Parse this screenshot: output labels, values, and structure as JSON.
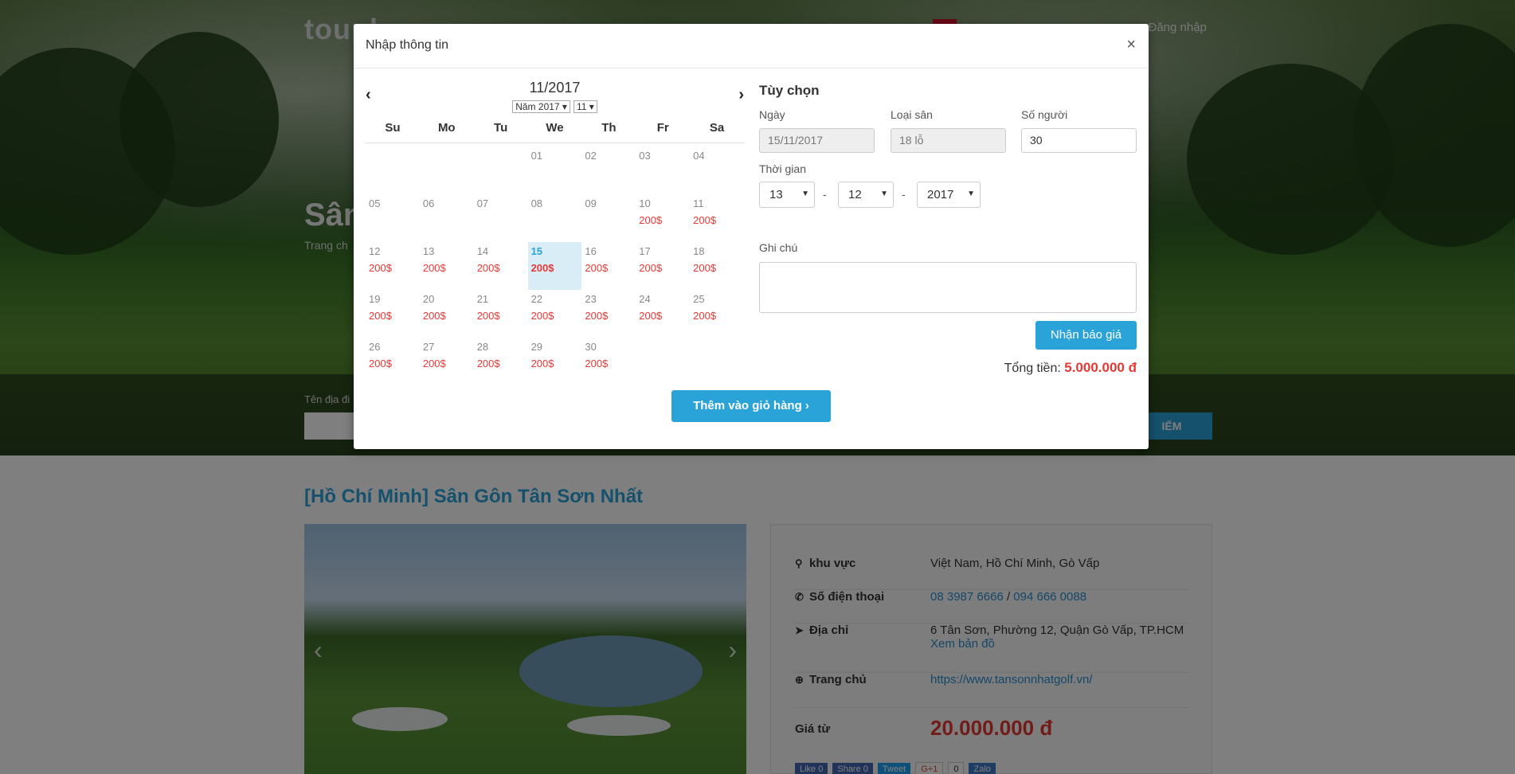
{
  "background": {
    "logo": "toupl",
    "login": "Đăng nhập",
    "hero_title": "Sân",
    "breadcrumb": "Trang ch",
    "search_label": "Tên địa đi",
    "search_button": "IẾM",
    "page_title": "[Hồ Chí Minh] Sân Gôn Tân Sơn Nhất",
    "info": {
      "area_label": "khu vực",
      "area_value": "Việt Nam, Hồ Chí Minh, Gò Vấp",
      "phone_label": "Số điện thoại",
      "phone_1": "08 3987 6666",
      "phone_sep": "/",
      "phone_2": "094 666 0088",
      "address_label": "Địa chỉ",
      "address_value": "6 Tân Sơn, Phường 12, Quận Gò Vấp, TP.HCM",
      "map_link": "Xem bản đồ",
      "home_label": "Trang chủ",
      "home_value": "https://www.tansonnhatgolf.vn/",
      "price_label": "Giá từ",
      "price_value": "20.000.000 đ"
    },
    "social": [
      "Like 0",
      "Share 0",
      "Tweet",
      "G+1",
      "0",
      "Zalo"
    ]
  },
  "modal": {
    "title": "Nhập thông tin",
    "close": "×",
    "calendar": {
      "month_label": "11/2017",
      "year_select": "Năm 2017",
      "month_select": "11",
      "weekdays": [
        "Su",
        "Mo",
        "Tu",
        "We",
        "Th",
        "Fr",
        "Sa"
      ],
      "leading_blanks": 3,
      "days": [
        {
          "d": "01",
          "p": ""
        },
        {
          "d": "02",
          "p": ""
        },
        {
          "d": "03",
          "p": ""
        },
        {
          "d": "04",
          "p": ""
        },
        {
          "d": "05",
          "p": ""
        },
        {
          "d": "06",
          "p": ""
        },
        {
          "d": "07",
          "p": ""
        },
        {
          "d": "08",
          "p": ""
        },
        {
          "d": "09",
          "p": ""
        },
        {
          "d": "10",
          "p": "200$"
        },
        {
          "d": "11",
          "p": "200$"
        },
        {
          "d": "12",
          "p": "200$"
        },
        {
          "d": "13",
          "p": "200$"
        },
        {
          "d": "14",
          "p": "200$"
        },
        {
          "d": "15",
          "p": "200$",
          "selected": true
        },
        {
          "d": "16",
          "p": "200$"
        },
        {
          "d": "17",
          "p": "200$"
        },
        {
          "d": "18",
          "p": "200$"
        },
        {
          "d": "19",
          "p": "200$"
        },
        {
          "d": "20",
          "p": "200$"
        },
        {
          "d": "21",
          "p": "200$"
        },
        {
          "d": "22",
          "p": "200$"
        },
        {
          "d": "23",
          "p": "200$"
        },
        {
          "d": "24",
          "p": "200$"
        },
        {
          "d": "25",
          "p": "200$"
        },
        {
          "d": "26",
          "p": "200$"
        },
        {
          "d": "27",
          "p": "200$"
        },
        {
          "d": "28",
          "p": "200$"
        },
        {
          "d": "29",
          "p": "200$"
        },
        {
          "d": "30",
          "p": "200$"
        }
      ]
    },
    "cart_button": "Thêm vào giỏ hàng ›",
    "options": {
      "title": "Tùy chọn",
      "date_label": "Ngày",
      "date_value": "15/11/2017",
      "course_label": "Loại sân",
      "course_value": "18 lỗ",
      "people_label": "Số người",
      "people_value": "30",
      "time_label": "Thời gian",
      "time_1": "13",
      "time_2": "12",
      "time_3": "2017",
      "dash": "-",
      "note_label": "Ghi chú",
      "quote_button": "Nhận báo giá",
      "total_label": "Tổng tiền:",
      "total_value": "5.000.000 đ"
    }
  }
}
